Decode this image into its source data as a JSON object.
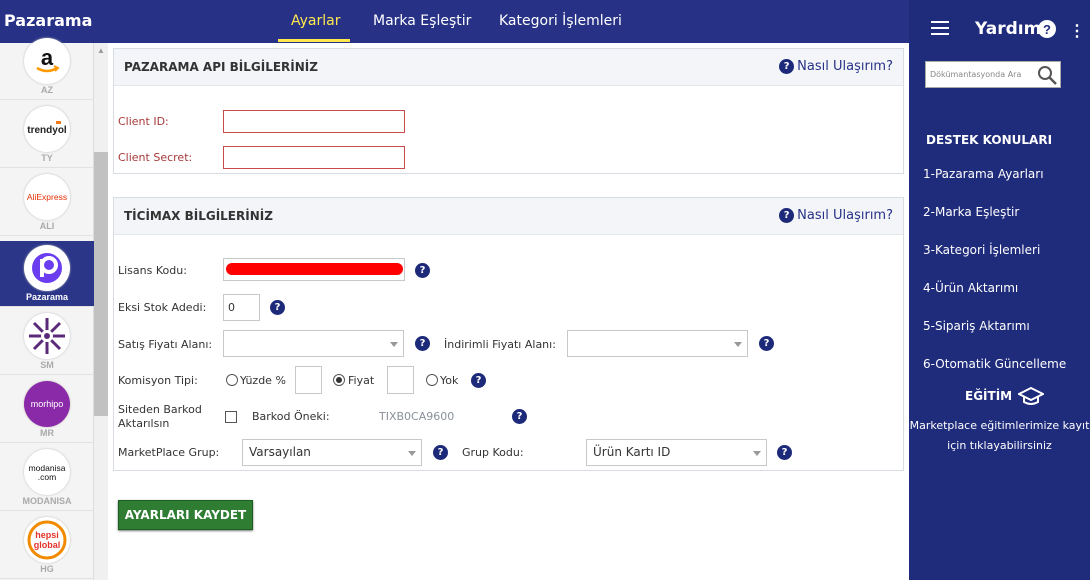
{
  "app": {
    "brand": "Pazarama"
  },
  "tabs": [
    {
      "label": "Ayarlar",
      "active": true
    },
    {
      "label": "Marka Eşleştir",
      "active": false
    },
    {
      "label": "Kategori İşlemleri",
      "active": false
    }
  ],
  "marketplaces": [
    {
      "code": "AZ",
      "logo": "a",
      "icon": "amazon-logo"
    },
    {
      "code": "TY",
      "logo": "trendyol",
      "icon": "trendyol-logo"
    },
    {
      "code": "ALI",
      "logo": "AliExpress",
      "icon": "aliexpress-logo"
    },
    {
      "code": "Pazarama",
      "logo": "P",
      "icon": "pazarama-logo",
      "active": true
    },
    {
      "code": "SM",
      "logo": "",
      "icon": "sm-logo"
    },
    {
      "code": "MR",
      "logo": "morhipo",
      "icon": "morhipo-logo"
    },
    {
      "code": "MODANISA",
      "logo": "modanisa .com",
      "icon": "modanisa-logo"
    },
    {
      "code": "HG",
      "logo": "hepsi global",
      "icon": "hepsiglobal-logo"
    }
  ],
  "api_section": {
    "title": "PAZARAMA API BİLGİLERİNİZ",
    "help_label": "Nasıl Ulaşırım?",
    "client_id_label": "Client ID:",
    "client_id_value": "",
    "client_secret_label": "Client Secret:",
    "client_secret_value": ""
  },
  "ticimax_section": {
    "title": "TİCİMAX BİLGİLERİNİZ",
    "help_label": "Nasıl Ulaşırım?",
    "license_label": "Lisans Kodu:",
    "stock_label": "Eksi Stok Adedi:",
    "stock_value": "0",
    "sale_price_label": "Satış Fiyatı Alanı:",
    "sale_price_value": "",
    "discount_price_label": "İndirimli Fiyatı Alanı:",
    "discount_price_value": "",
    "commission_label": "Komisyon Tipi:",
    "commission_options": [
      "Yüzde %",
      "Fiyat",
      "Yok"
    ],
    "commission_selected": "Fiyat",
    "barcode_label": "Siteden Barkod Aktarılsın",
    "barcode_prefix_label": "Barkod Öneki:",
    "barcode_prefix_value": "TIXB0CA9600",
    "marketplace_group_label": "MarketPlace Grup:",
    "marketplace_group_value": "Varsayılan",
    "group_code_label": "Grup Kodu:",
    "group_code_value": "Ürün Kartı ID"
  },
  "save_button": "AYARLARI KAYDET",
  "help_panel": {
    "title": "Yardım",
    "search_placeholder": "Dökümantasyonda Ara",
    "support_title": "DESTEK KONULARI",
    "support_items": [
      "1-Pazarama Ayarları",
      "2-Marka Eşleştir",
      "3-Kategori İşlemleri",
      "4-Ürün Aktarımı",
      "5-Sipariş Aktarımı",
      "6-Otomatik Güncelleme"
    ],
    "education_title": "EĞİTİM",
    "education_text": "Marketplace eğitimlerimize kayıt için tıklayabilirsiniz"
  },
  "colors": {
    "nav_bg": "#273287",
    "help_bg": "#1f2b7b",
    "active_tab": "#ffe84d",
    "save_button": "#2e7d32",
    "error_border": "#c94a4a"
  }
}
